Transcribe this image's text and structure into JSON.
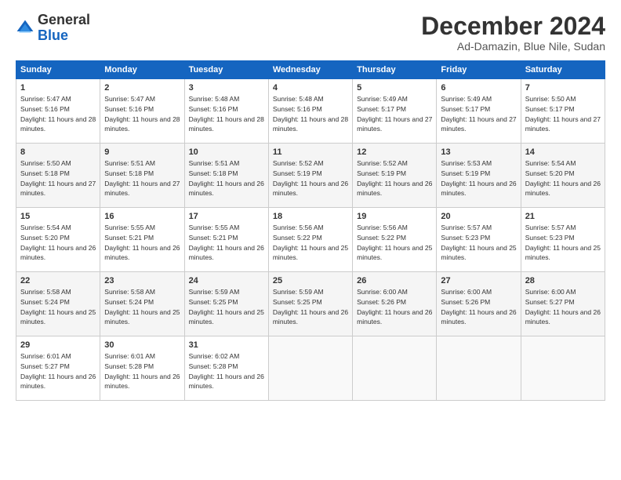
{
  "logo": {
    "general": "General",
    "blue": "Blue"
  },
  "header": {
    "month": "December 2024",
    "location": "Ad-Damazin, Blue Nile, Sudan"
  },
  "days_of_week": [
    "Sunday",
    "Monday",
    "Tuesday",
    "Wednesday",
    "Thursday",
    "Friday",
    "Saturday"
  ],
  "weeks": [
    [
      {
        "day": "1",
        "sunrise": "5:47 AM",
        "sunset": "5:16 PM",
        "daylight": "11 hours and 28 minutes."
      },
      {
        "day": "2",
        "sunrise": "5:47 AM",
        "sunset": "5:16 PM",
        "daylight": "11 hours and 28 minutes."
      },
      {
        "day": "3",
        "sunrise": "5:48 AM",
        "sunset": "5:16 PM",
        "daylight": "11 hours and 28 minutes."
      },
      {
        "day": "4",
        "sunrise": "5:48 AM",
        "sunset": "5:16 PM",
        "daylight": "11 hours and 28 minutes."
      },
      {
        "day": "5",
        "sunrise": "5:49 AM",
        "sunset": "5:17 PM",
        "daylight": "11 hours and 27 minutes."
      },
      {
        "day": "6",
        "sunrise": "5:49 AM",
        "sunset": "5:17 PM",
        "daylight": "11 hours and 27 minutes."
      },
      {
        "day": "7",
        "sunrise": "5:50 AM",
        "sunset": "5:17 PM",
        "daylight": "11 hours and 27 minutes."
      }
    ],
    [
      {
        "day": "8",
        "sunrise": "5:50 AM",
        "sunset": "5:18 PM",
        "daylight": "11 hours and 27 minutes."
      },
      {
        "day": "9",
        "sunrise": "5:51 AM",
        "sunset": "5:18 PM",
        "daylight": "11 hours and 27 minutes."
      },
      {
        "day": "10",
        "sunrise": "5:51 AM",
        "sunset": "5:18 PM",
        "daylight": "11 hours and 26 minutes."
      },
      {
        "day": "11",
        "sunrise": "5:52 AM",
        "sunset": "5:19 PM",
        "daylight": "11 hours and 26 minutes."
      },
      {
        "day": "12",
        "sunrise": "5:52 AM",
        "sunset": "5:19 PM",
        "daylight": "11 hours and 26 minutes."
      },
      {
        "day": "13",
        "sunrise": "5:53 AM",
        "sunset": "5:19 PM",
        "daylight": "11 hours and 26 minutes."
      },
      {
        "day": "14",
        "sunrise": "5:54 AM",
        "sunset": "5:20 PM",
        "daylight": "11 hours and 26 minutes."
      }
    ],
    [
      {
        "day": "15",
        "sunrise": "5:54 AM",
        "sunset": "5:20 PM",
        "daylight": "11 hours and 26 minutes."
      },
      {
        "day": "16",
        "sunrise": "5:55 AM",
        "sunset": "5:21 PM",
        "daylight": "11 hours and 26 minutes."
      },
      {
        "day": "17",
        "sunrise": "5:55 AM",
        "sunset": "5:21 PM",
        "daylight": "11 hours and 26 minutes."
      },
      {
        "day": "18",
        "sunrise": "5:56 AM",
        "sunset": "5:22 PM",
        "daylight": "11 hours and 25 minutes."
      },
      {
        "day": "19",
        "sunrise": "5:56 AM",
        "sunset": "5:22 PM",
        "daylight": "11 hours and 25 minutes."
      },
      {
        "day": "20",
        "sunrise": "5:57 AM",
        "sunset": "5:23 PM",
        "daylight": "11 hours and 25 minutes."
      },
      {
        "day": "21",
        "sunrise": "5:57 AM",
        "sunset": "5:23 PM",
        "daylight": "11 hours and 25 minutes."
      }
    ],
    [
      {
        "day": "22",
        "sunrise": "5:58 AM",
        "sunset": "5:24 PM",
        "daylight": "11 hours and 25 minutes."
      },
      {
        "day": "23",
        "sunrise": "5:58 AM",
        "sunset": "5:24 PM",
        "daylight": "11 hours and 25 minutes."
      },
      {
        "day": "24",
        "sunrise": "5:59 AM",
        "sunset": "5:25 PM",
        "daylight": "11 hours and 25 minutes."
      },
      {
        "day": "25",
        "sunrise": "5:59 AM",
        "sunset": "5:25 PM",
        "daylight": "11 hours and 26 minutes."
      },
      {
        "day": "26",
        "sunrise": "6:00 AM",
        "sunset": "5:26 PM",
        "daylight": "11 hours and 26 minutes."
      },
      {
        "day": "27",
        "sunrise": "6:00 AM",
        "sunset": "5:26 PM",
        "daylight": "11 hours and 26 minutes."
      },
      {
        "day": "28",
        "sunrise": "6:00 AM",
        "sunset": "5:27 PM",
        "daylight": "11 hours and 26 minutes."
      }
    ],
    [
      {
        "day": "29",
        "sunrise": "6:01 AM",
        "sunset": "5:27 PM",
        "daylight": "11 hours and 26 minutes."
      },
      {
        "day": "30",
        "sunrise": "6:01 AM",
        "sunset": "5:28 PM",
        "daylight": "11 hours and 26 minutes."
      },
      {
        "day": "31",
        "sunrise": "6:02 AM",
        "sunset": "5:28 PM",
        "daylight": "11 hours and 26 minutes."
      },
      null,
      null,
      null,
      null
    ]
  ]
}
